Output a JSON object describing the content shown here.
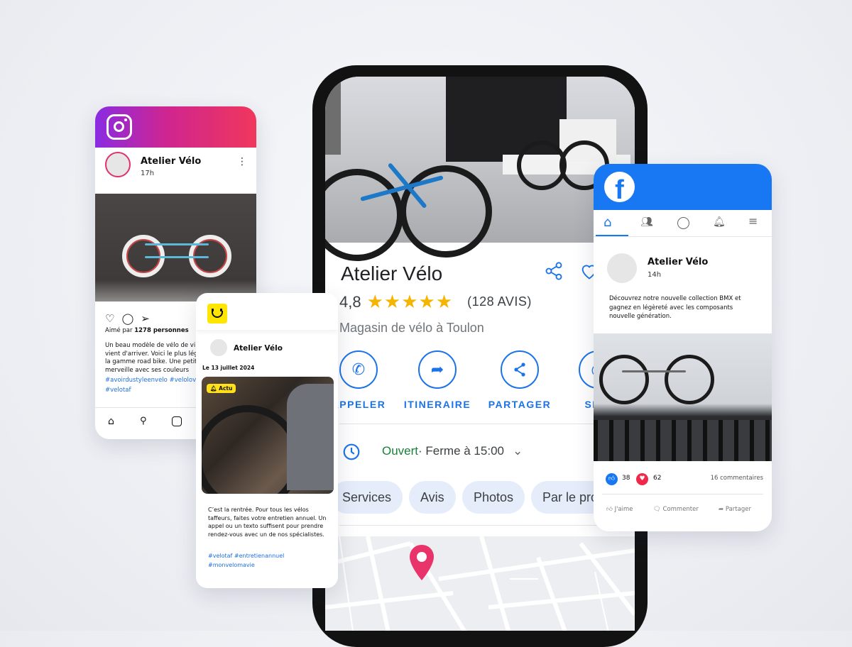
{
  "google": {
    "business_name": "Atelier Vélo",
    "rating": "4,8",
    "stars": "★★★★★",
    "reviews": "(128 AVIS)",
    "category": "Magasin de vélo à Toulon",
    "actions": [
      {
        "label": "APPELER",
        "icon": "phone-icon"
      },
      {
        "label": "ITINERAIRE",
        "icon": "directions-icon"
      },
      {
        "label": "PARTAGER",
        "icon": "share-icon"
      },
      {
        "label": "SITE",
        "icon": "globe-icon"
      }
    ],
    "status_open": "Ouvert",
    "status_close": " · Ferme à 15:00",
    "chips": [
      "Services",
      "Avis",
      "Photos",
      "Par le propriétaire"
    ],
    "accent": "#1a73e8",
    "open_color": "#188038"
  },
  "instagram": {
    "name": "Atelier Vélo",
    "time": "17h",
    "likes_prefix": "Aimé par ",
    "likes": "1278 personnes",
    "caption": "Un beau modèle de vélo de ville vient d'arriver. Voici le plus léger de la gamme road bike. Une petite merveille avec ses couleurs",
    "hashtags_1": "#avoirdustyleenvelo #velolove",
    "hashtags_2": "#velotaf"
  },
  "yellow_app": {
    "name": "Atelier Vélo",
    "date": "Le 13 juillet 2024",
    "badge": "Actu",
    "text": "C’est la rentrée. Pour tous les vélos taffeurs, faites votre entretien annuel. Un appel ou un texto suffisent pour prendre rendez-vous avec un de nos spécialistes.",
    "hashtags_1": "#velotaf #entretienannuel",
    "hashtags_2": "#monvelomavie"
  },
  "facebook": {
    "name": "Atelier Vélo",
    "time": "14h",
    "text": "Découvrez notre nouvelle collection BMX et gagnez en légèreté avec les composants nouvelle génération.",
    "likes": "38",
    "hearts": "62",
    "comments": "16 commentaires",
    "like_label": "J'aime",
    "comment_label": "Commenter",
    "share_label": "Partager",
    "brand": "#1877f2"
  }
}
